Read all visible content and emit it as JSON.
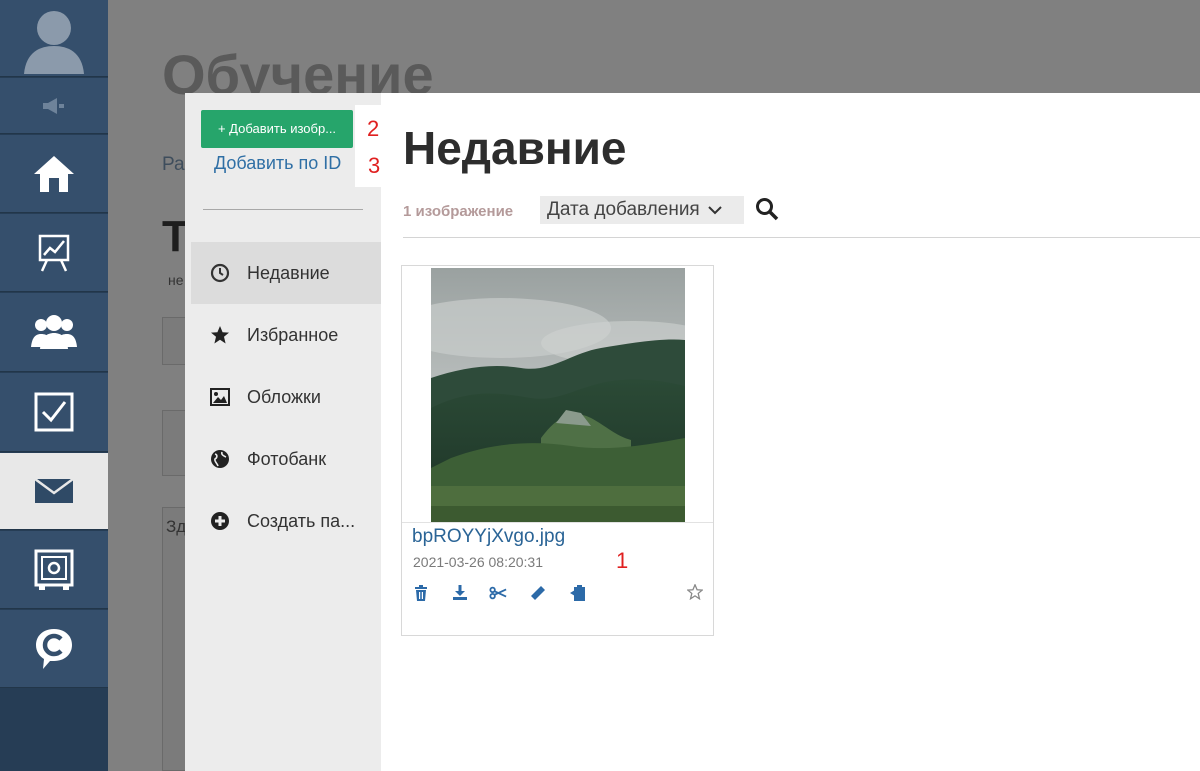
{
  "background": {
    "page_title": "Обучение",
    "fragment_a": "Ра",
    "fragment_b": "Т",
    "fragment_c": "не",
    "fragment_d": "Зд"
  },
  "rail": {
    "items": [
      "avatar",
      "announcement-icon",
      "home-icon",
      "chart-icon",
      "users-icon",
      "tasks-icon",
      "mail-icon",
      "safe-icon",
      "chat-icon"
    ],
    "active": "mail-icon"
  },
  "modal": {
    "add_button_label": "+ Добавить изобр...",
    "add_by_id_label": "Добавить по ID",
    "annotation_2": "2",
    "annotation_3": "3",
    "nav": [
      {
        "label": "Недавние",
        "icon": "clock-icon",
        "active": true
      },
      {
        "label": "Избранное",
        "icon": "star-icon",
        "active": false
      },
      {
        "label": "Обложки",
        "icon": "image-icon",
        "active": false
      },
      {
        "label": "Фотобанк",
        "icon": "globe-icon",
        "active": false
      },
      {
        "label": "Создать па...",
        "icon": "plus-circle-icon",
        "active": false
      }
    ],
    "title": "Недавние",
    "count_label": "1 изображение",
    "sort_label": "Дата добавления",
    "image": {
      "filename": "bpROYYjXvgo.jpg",
      "date": "2021-03-26 08:20:31",
      "annotation": "1"
    }
  },
  "colors": {
    "rail_bg": "#354f6c",
    "accent_green": "#26a56b",
    "link_blue": "#2f6fa5",
    "annotation_red": "#e02020"
  }
}
